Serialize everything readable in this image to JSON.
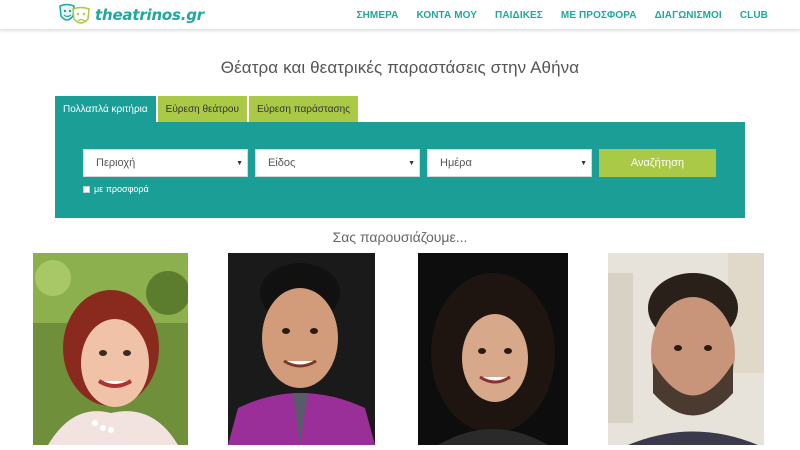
{
  "header": {
    "logo_text": "theatrinos.gr",
    "nav": [
      {
        "label": "ΣΗΜΕΡΑ"
      },
      {
        "label": "ΚΟΝΤΑ ΜΟΥ"
      },
      {
        "label": "ΠΑΙΔΙΚΕΣ"
      },
      {
        "label": "ΜΕ ΠΡΟΣΦΟΡΑ"
      },
      {
        "label": "ΔΙΑΓΩΝΙΣΜΟΙ"
      },
      {
        "label": "CLUB"
      }
    ]
  },
  "main": {
    "title": "Θέατρα και θεατρικές παραστάσεις στην Αθήνα",
    "tabs": [
      {
        "label": "Πολλαπλά κριτήρια",
        "active": true
      },
      {
        "label": "Εύρεση θεάτρου",
        "active": false
      },
      {
        "label": "Εύρεση παράστασης",
        "active": false
      }
    ],
    "search": {
      "region": "Περιοχή",
      "genre": "Είδος",
      "day": "Ημέρα",
      "button": "Αναζήτηση",
      "offer_checkbox": "με προσφορά"
    },
    "presenting": "Σας παρουσιάζουμε...",
    "photos": [
      {
        "icon": "person-photo-woman-red-hair"
      },
      {
        "icon": "person-photo-man-purple-shirt"
      },
      {
        "icon": "person-photo-woman-curly-hair"
      },
      {
        "icon": "person-photo-man-beard"
      }
    ]
  },
  "colors": {
    "brand_teal": "#1a9e96",
    "accent_green": "#a9c947",
    "nav_text": "#1fa7a0"
  }
}
